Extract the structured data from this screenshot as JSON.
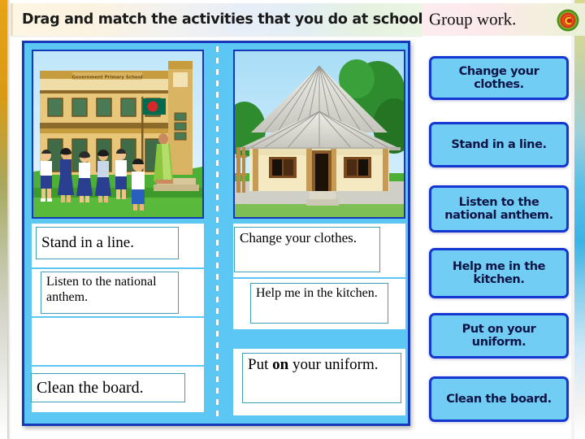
{
  "slide": {
    "title": "Drag and match the activities that you do at school or at home.",
    "group_label": "Group work.",
    "badge_glyph": "C",
    "badge_name": "group-work-badge-icon"
  },
  "colors": {
    "panel_fill": "#5cc7f2",
    "panel_border": "#1438b8",
    "button_fill": "#72cdf5",
    "button_border": "#1438cf",
    "button_text": "#0c1446",
    "tile_border": "#3f9fb5",
    "edge_orange": "#e8a317"
  },
  "illustrations": [
    {
      "name": "school-illustration",
      "alt": "Primary school building with students standing in line and a teacher, national flag on pole",
      "caption": "Government Primary School"
    },
    {
      "name": "home-illustration",
      "alt": "Rural village house with tin roof, wooden door and shuttered windows, trees behind"
    }
  ],
  "columns": [
    {
      "name": "school-column",
      "tiles": [
        {
          "text": "Stand in a line.",
          "lines": 1,
          "size": 19
        },
        {
          "text": "Listen to the national anthem.",
          "lines": 2,
          "size": 16
        },
        {
          "text": "Clean the board.",
          "lines": 1,
          "size": 20
        }
      ]
    },
    {
      "name": "home-column",
      "tiles": [
        {
          "text": "Change your clothes.",
          "lines": 2,
          "size": 17
        },
        {
          "text": "Help me in the kitchen.",
          "lines": 2,
          "size": 16
        },
        {
          "text": "Put on your uniform.",
          "lines": 2,
          "size": 19,
          "bold_word": "on"
        }
      ]
    }
  ],
  "word_bank": {
    "name": "word-bank",
    "buttons": [
      {
        "label": "Change your clothes."
      },
      {
        "label": "Stand in a line."
      },
      {
        "label": "Listen to the national anthem."
      },
      {
        "label": "Help me in the kitchen."
      },
      {
        "label": "Put on your uniform."
      },
      {
        "label": "Clean the board."
      }
    ]
  }
}
